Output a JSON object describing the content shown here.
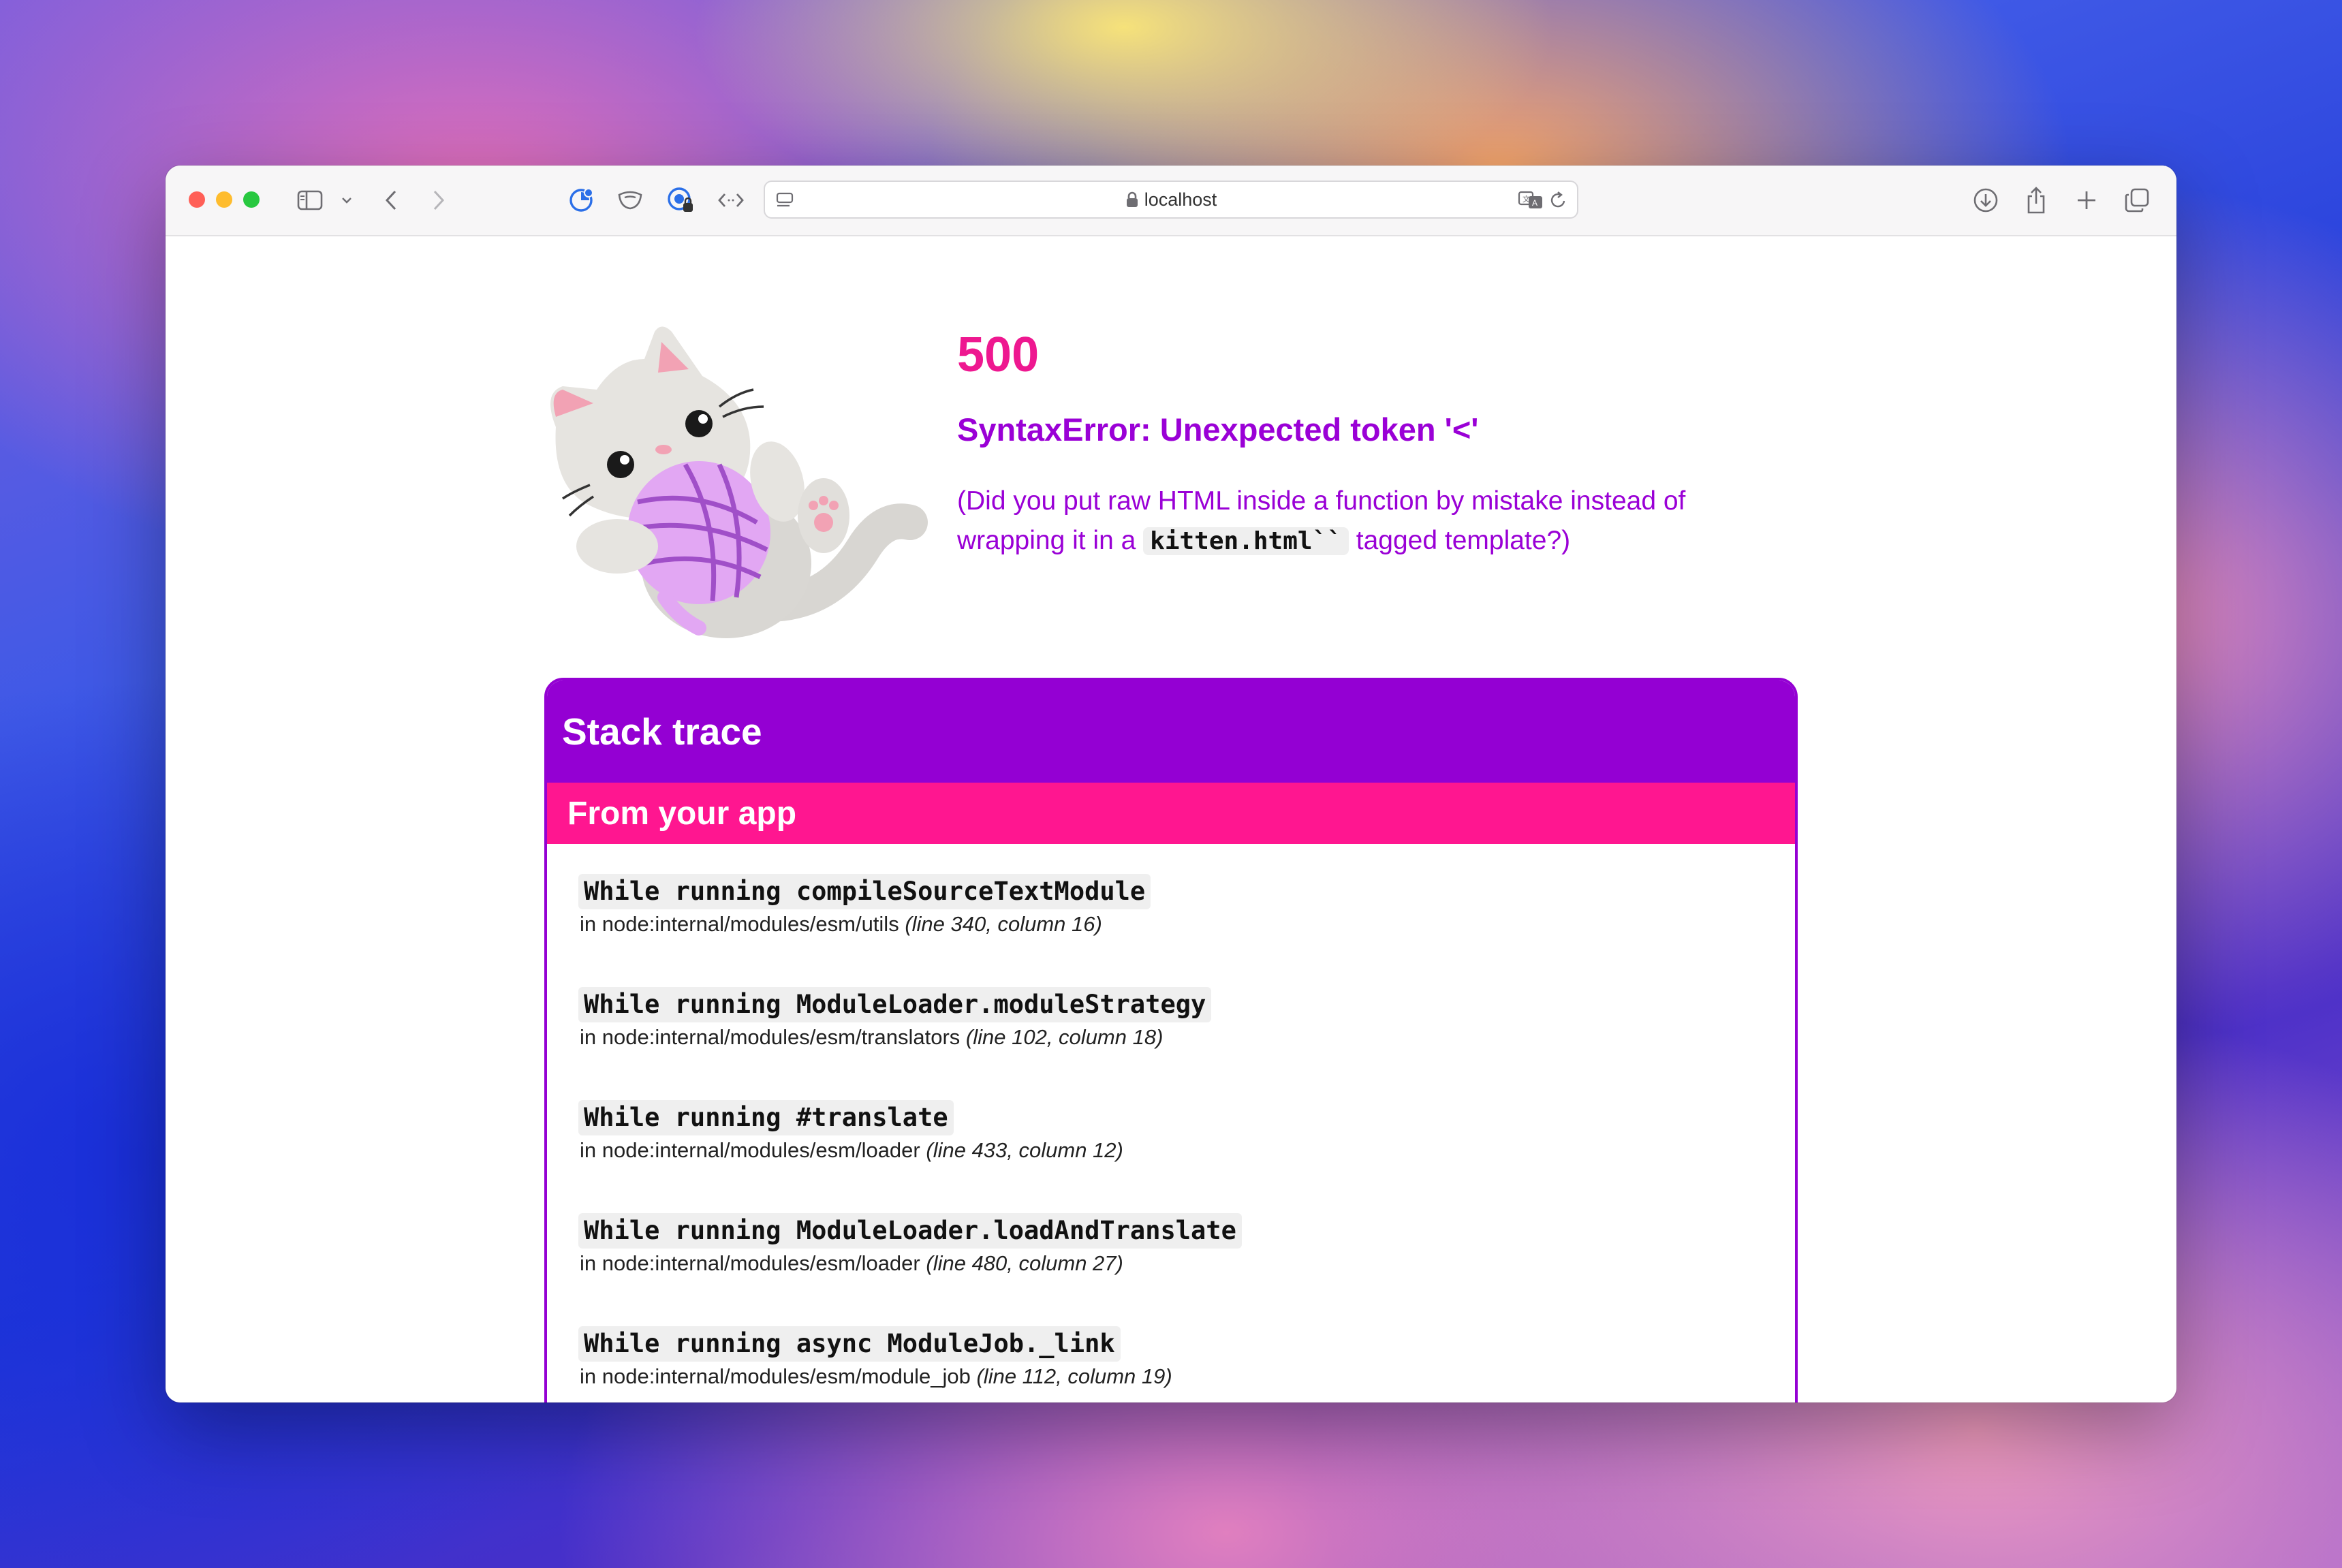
{
  "browser": {
    "url": "localhost",
    "colors": {
      "close": "#ff5f57",
      "minimize": "#febc2e",
      "zoom": "#28c840"
    },
    "toolbar_icons": [
      "sidebar-icon",
      "chevron-down-icon",
      "back-icon",
      "forward-icon",
      "extension-icon",
      "privacy-icon",
      "password-icon",
      "code-icon",
      "reader-icon",
      "lock-icon",
      "translate-icon",
      "reload-icon",
      "download-icon",
      "share-icon",
      "new-tab-icon",
      "tabs-overview-icon"
    ]
  },
  "error": {
    "code": "500",
    "title": "SyntaxError: Unexpected token '<'",
    "hint_before": "(Did you put raw HTML inside a function by mistake instead of wrapping it in a ",
    "hint_code": "kitten.html``",
    "hint_after": " tagged template?)"
  },
  "stack": {
    "title": "Stack trace",
    "section": "From your app",
    "frames": [
      {
        "fn": "While running compileSourceTextModule",
        "file": "in node:internal/modules/esm/utils",
        "pos": "(line 340, column 16)"
      },
      {
        "fn": "While running ModuleLoader.moduleStrategy",
        "file": "in node:internal/modules/esm/translators",
        "pos": "(line 102, column 18)"
      },
      {
        "fn": "While running #translate",
        "file": "in node:internal/modules/esm/loader",
        "pos": "(line 433, column 12)"
      },
      {
        "fn": "While running ModuleLoader.loadAndTranslate",
        "file": "in node:internal/modules/esm/loader",
        "pos": "(line 480, column 27)"
      },
      {
        "fn": "While running async ModuleJob._link",
        "file": "in node:internal/modules/esm/module_job",
        "pos": "(line 112, column 19)"
      }
    ]
  },
  "theme": {
    "pink": "#ee1890",
    "purple": "#9400d3"
  }
}
